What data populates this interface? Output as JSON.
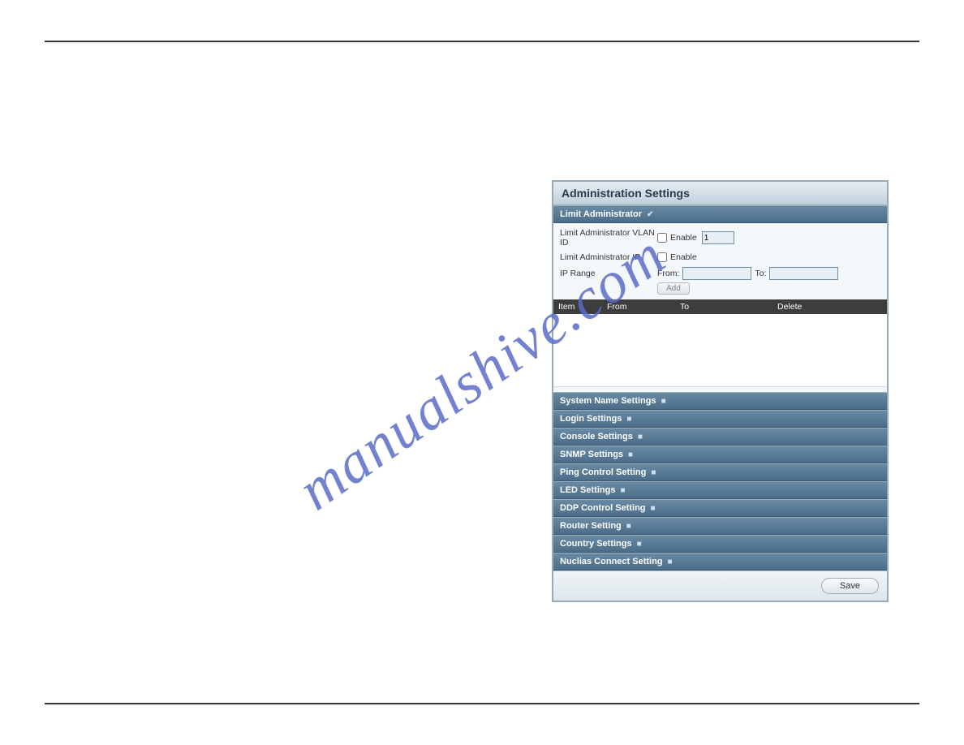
{
  "watermark": "manualshive.com",
  "panel": {
    "title": "Administration Settings",
    "limit_admin": {
      "header": "Limit Administrator",
      "expanded": true,
      "vlan_label": "Limit Administrator VLAN ID",
      "vlan_enable_label": "Enable",
      "vlan_value": "1",
      "ip_label": "Limit Administrator IP",
      "ip_enable_label": "Enable",
      "range_label": "IP Range",
      "from_label": "From:",
      "to_label": "To:",
      "add_label": "Add",
      "table_headers": {
        "item": "Item",
        "from": "From",
        "to": "To",
        "delete": "Delete"
      }
    },
    "sections": [
      {
        "label": "System Name Settings"
      },
      {
        "label": "Login Settings"
      },
      {
        "label": "Console Settings"
      },
      {
        "label": "SNMP Settings"
      },
      {
        "label": "Ping Control Setting"
      },
      {
        "label": "LED Settings"
      },
      {
        "label": "DDP Control Setting"
      },
      {
        "label": "Router Setting"
      },
      {
        "label": "Country Settings"
      },
      {
        "label": "Nuclias Connect Setting"
      }
    ],
    "save_label": "Save"
  }
}
